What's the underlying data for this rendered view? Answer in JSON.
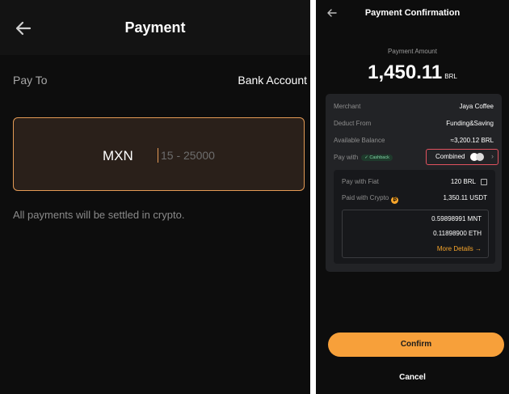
{
  "left_screen": {
    "title": "Payment",
    "pay_to_label": "Pay To",
    "pay_to_value": "Bank Account",
    "amount_currency": "MXN",
    "amount_placeholder": "15 - 25000",
    "settlement_note": "All payments will be settled in crypto."
  },
  "right_screen": {
    "title": "Payment Confirmation",
    "payment_amount_label": "Payment Amount",
    "payment_amount_value": "1,450.11",
    "payment_amount_currency": "BRL",
    "details": {
      "merchant_label": "Merchant",
      "merchant_value": "Jaya Coffee",
      "deduct_from_label": "Deduct From",
      "deduct_from_value": "Funding&Saving",
      "available_balance_label": "Available Balance",
      "available_balance_value": "≈3,200.12 BRL",
      "pay_with_label": "Pay with",
      "cashback_badge": "✓ Cashback",
      "pay_with_value": "Combined"
    },
    "breakdown": {
      "pay_with_fiat_label": "Pay with Fiat",
      "pay_with_fiat_value": "120 BRL",
      "paid_with_crypto_label": "Paid with Crypto",
      "paid_with_crypto_value": "1,350.11 USDT",
      "crypto_lines": [
        "0.59898991 MNT",
        "0.11898900 ETH"
      ],
      "more_details": "More Details →"
    },
    "confirm_label": "Confirm",
    "cancel_label": "Cancel"
  },
  "colors": {
    "accent_orange": "#f7a03a",
    "highlight_red": "#e2525f",
    "cashback_green": "#7fd3a5",
    "background_dark": "#0d0d0d"
  }
}
